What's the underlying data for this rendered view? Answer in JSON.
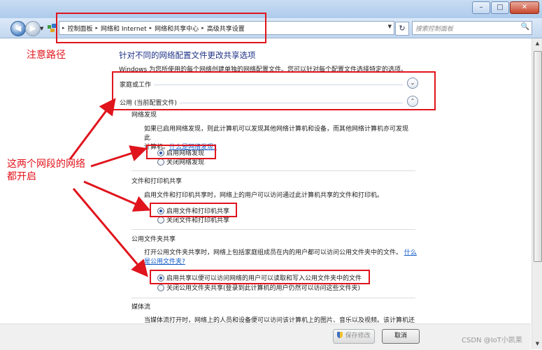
{
  "window": {
    "min": "–",
    "max": "□",
    "close": "✕"
  },
  "nav": {
    "back": "◀",
    "forward": "▶",
    "hist_drop": "▼"
  },
  "address": {
    "crumbs": [
      "控制面板",
      "网络和 Internet",
      "网络和共享中心",
      "高级共享设置"
    ],
    "sep": "▸",
    "drop": "▼",
    "refresh": "↻"
  },
  "search": {
    "placeholder": "搜索控制面板",
    "icon": "🔍"
  },
  "page": {
    "title": "针对不同的网络配置文件更改共享选项",
    "subtitle": "Windows 为您所使用的每个网络创建单独的网络配置文件。您可以针对每个配置文件选择特定的选项。"
  },
  "profiles": [
    {
      "label": "家庭或工作",
      "chev": "⌄"
    },
    {
      "label": "公用 (当前配置文件)",
      "chev": "⌃"
    }
  ],
  "sections": {
    "discovery": {
      "title": "网络发现",
      "desc1": "如果已启用网络发现，则此计算机可以发现其他网络计算机和设备，而其他网络计算机亦可发现此",
      "desc2": "计算机。",
      "link": "什么是网络发现?",
      "opt_on": "启用网络发现",
      "opt_off": "关闭网络发现"
    },
    "fileprint": {
      "title": "文件和打印机共享",
      "desc": "启用文件和打印机共享时，网络上的用户可以访问通过此计算机共享的文件和打印机。",
      "opt_on": "启用文件和打印机共享",
      "opt_off": "关闭文件和打印机共享"
    },
    "public_folder": {
      "title": "公用文件夹共享",
      "desc": "打开公用文件夹共享时，网络上包括家庭组成员在内的用户都可以访问公用文件夹中的文件。",
      "link1": "什么",
      "link2": "是公用文件夹?",
      "opt_on": "启用共享以便可以访问网络的用户可以读取和写入公用文件夹中的文件",
      "opt_off": "关闭公用文件夹共享(登录到此计算机的用户仍然可以访问这些文件夹)"
    },
    "media": {
      "title": "媒体流",
      "desc": "当媒体流打开时，网络上的人员和设备便可以访问该计算机上的图片、音乐以及视频。该计算机还"
    }
  },
  "buttons": {
    "save": "保存修改",
    "cancel": "取消"
  },
  "annotations": {
    "path_note": "注意路径",
    "both_note_1": "这两个网段的网络",
    "both_note_2": "都开启"
  },
  "watermark": "CSDN @IoT小凯莱",
  "colors": {
    "annotation": "#e0141c",
    "title": "#1e3287",
    "link": "#0b57c8"
  }
}
